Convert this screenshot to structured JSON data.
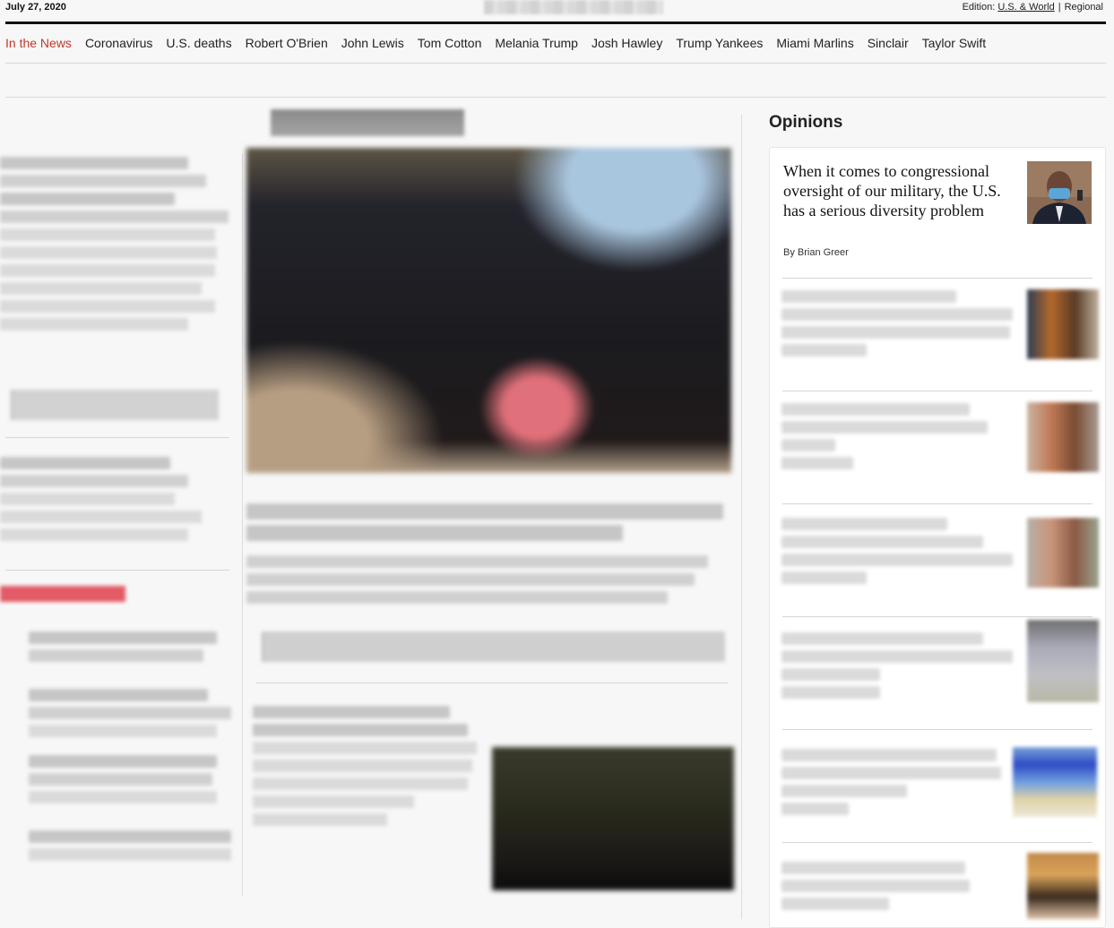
{
  "header": {
    "date": "July 27, 2020",
    "edition_label": "Edition:",
    "edition_us_world": "U.S. & World",
    "edition_separator": "|",
    "edition_regional": "Regional"
  },
  "nav": {
    "items": [
      {
        "label": "In the News",
        "active": true
      },
      {
        "label": "Coronavirus"
      },
      {
        "label": "U.S. deaths"
      },
      {
        "label": "Robert O'Brien"
      },
      {
        "label": "John Lewis"
      },
      {
        "label": "Tom Cotton"
      },
      {
        "label": "Melania Trump"
      },
      {
        "label": "Josh Hawley"
      },
      {
        "label": "Trump Yankees"
      },
      {
        "label": "Miami Marlins"
      },
      {
        "label": "Sinclair"
      },
      {
        "label": "Taylor Swift"
      }
    ]
  },
  "opinions": {
    "section_title": "Opinions",
    "featured": {
      "headline": "When it comes to congressional oversight of our military, the U.S. has a serious diversity problem",
      "byline": "By Brian Greer"
    }
  },
  "colors": {
    "accent": "#c0392b",
    "rule": "#111111"
  }
}
